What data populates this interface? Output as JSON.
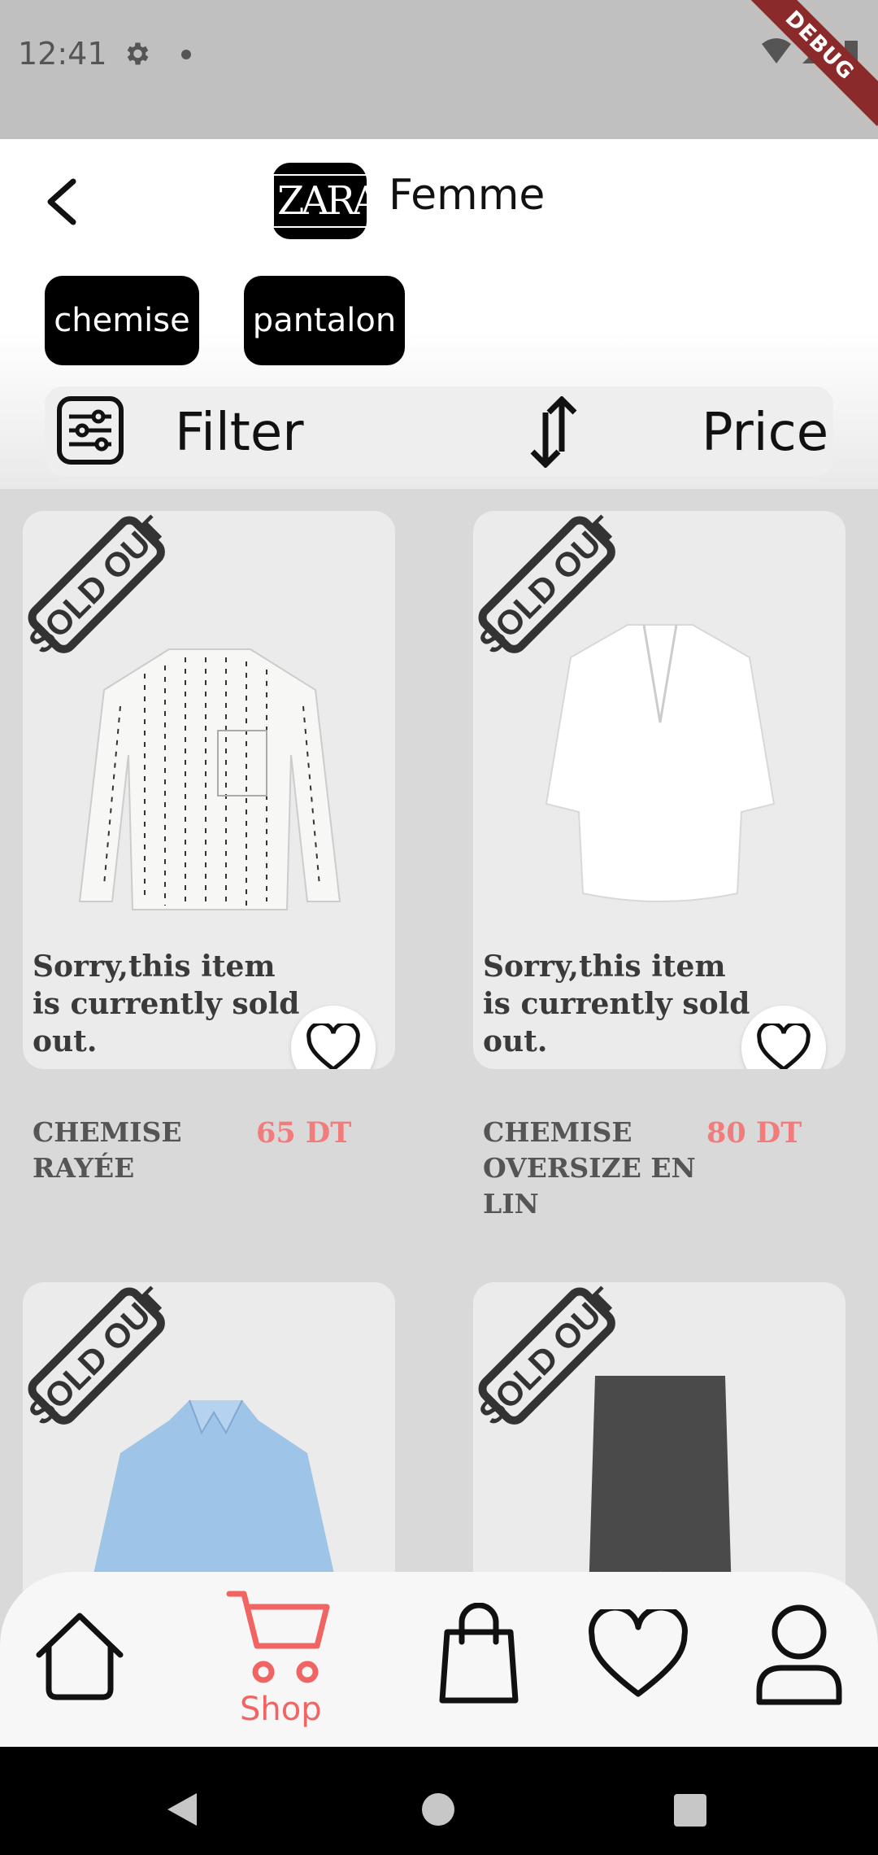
{
  "status_bar": {
    "time": "12:41",
    "debug_label": "DEBUG"
  },
  "header": {
    "logo_text": "ZARA",
    "title": "Femme"
  },
  "categories": [
    {
      "label": "chemise"
    },
    {
      "label": "pantalon"
    }
  ],
  "filter_bar": {
    "filter_label": "Filter",
    "sort_label": "Price"
  },
  "products": [
    {
      "name": "CHEMISE RAYÉE",
      "price": "65 DT",
      "sold_out_message": "Sorry,this item is currently sold out.",
      "badge": "SOLD OUT"
    },
    {
      "name": "CHEMISE OVERSIZE EN LIN",
      "price": "80 DT",
      "sold_out_message": "Sorry,this item is currently sold out.",
      "badge": "SOLD OUT"
    },
    {
      "badge": "SOLD OUT"
    },
    {
      "badge": "SOLD OUT"
    }
  ],
  "bottom_nav": {
    "active": "Shop",
    "shop_label": "Shop"
  },
  "colors": {
    "accent": "#f16464",
    "price": "#f27b7b",
    "chip_bg": "#000000"
  }
}
